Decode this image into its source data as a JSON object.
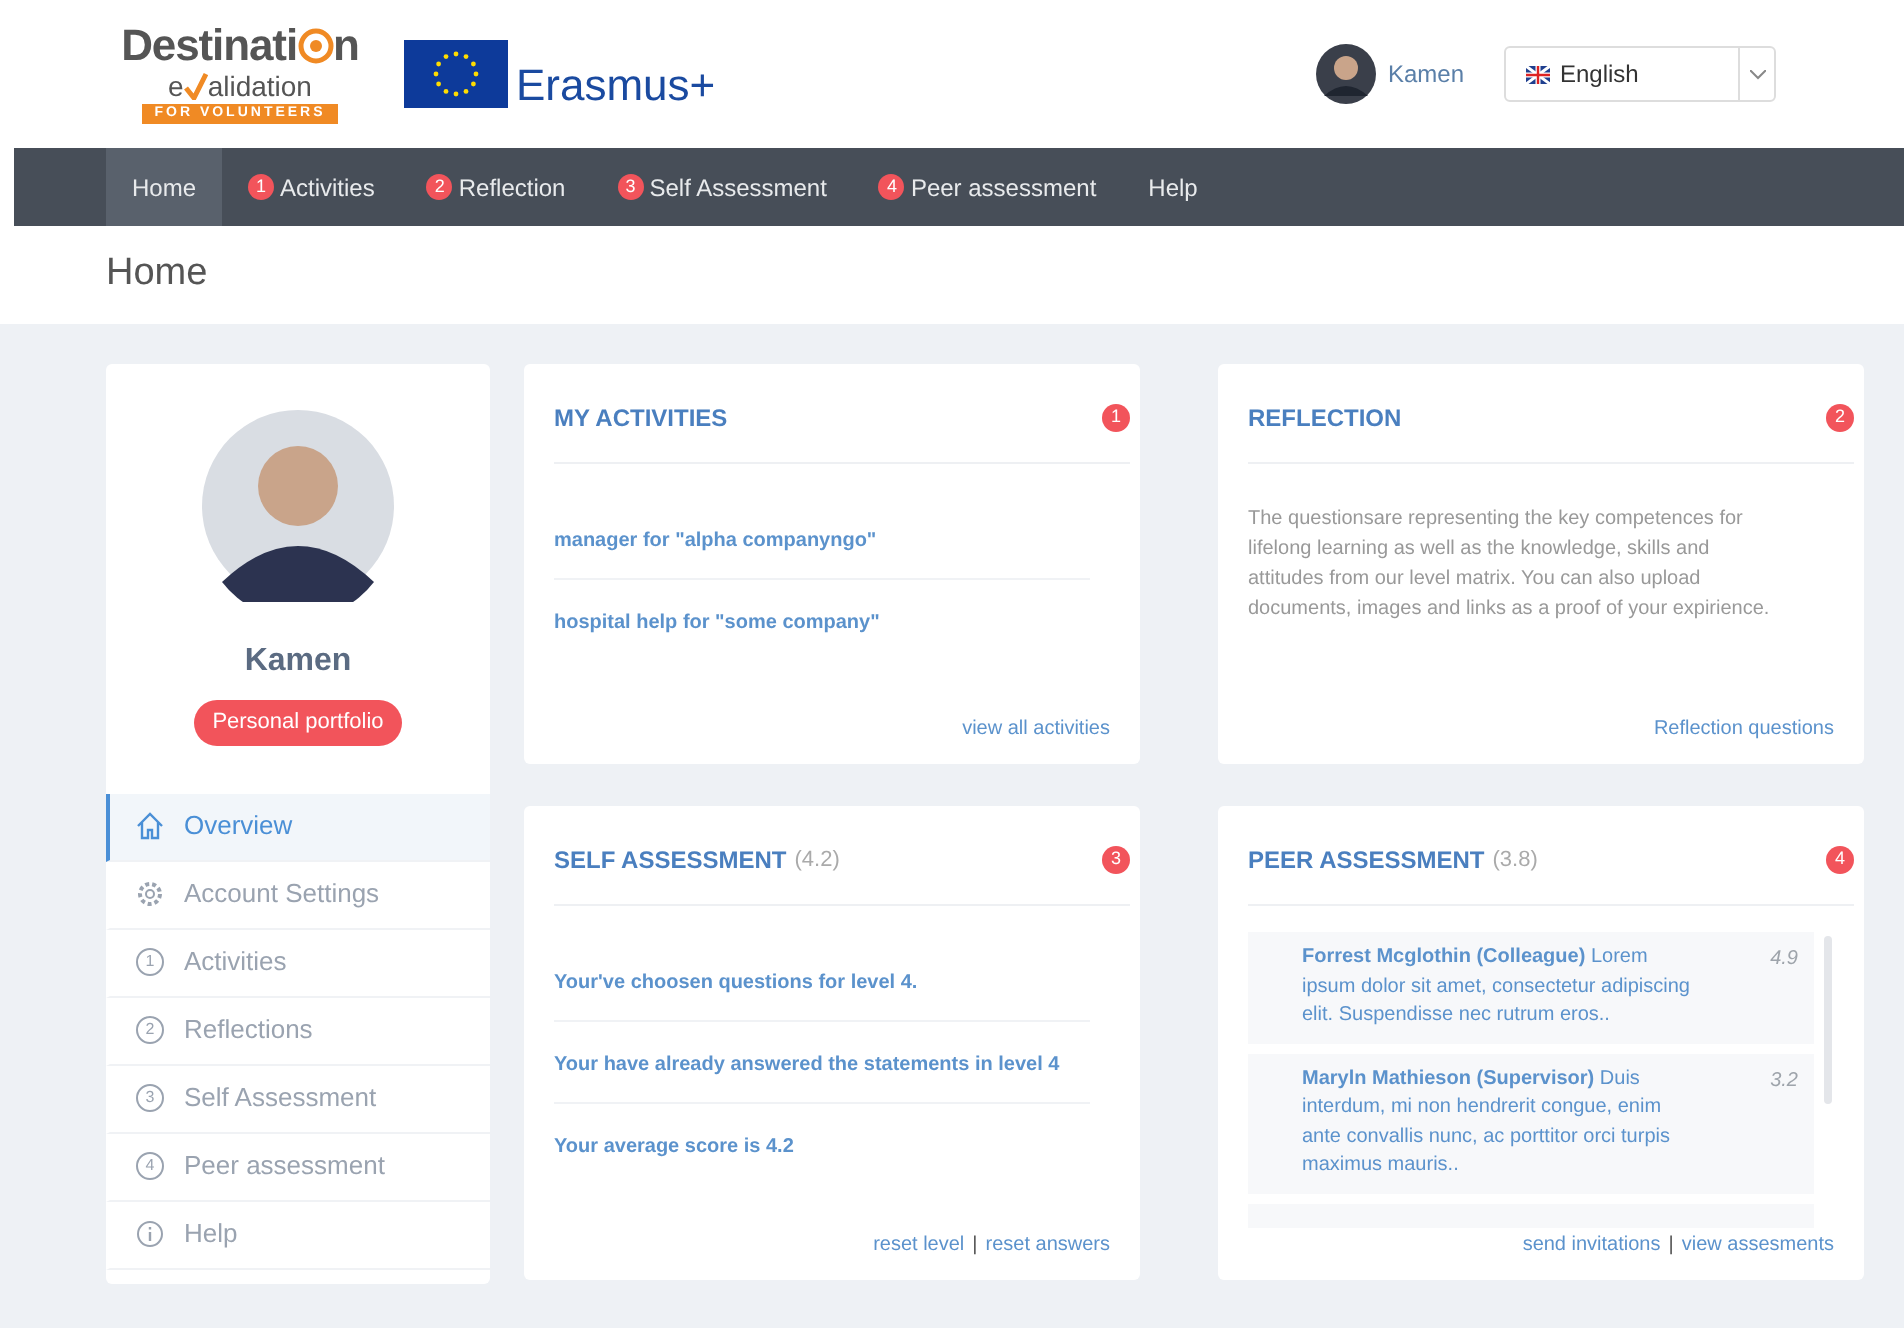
{
  "logo": {
    "word_start": "Destinati",
    "word_end": "n",
    "sub_start": "e",
    "sub_end": "alidation",
    "tagline": "FOR VOLUNTEERS"
  },
  "partner_logo": {
    "text": "Erasmus+"
  },
  "user": {
    "name": "Kamen"
  },
  "language": {
    "value": "English"
  },
  "nav": [
    {
      "label": "Home",
      "selected": true
    },
    {
      "label": "Activities",
      "badge": "1",
      "selected": false
    },
    {
      "label": "Reflection",
      "badge": "2",
      "selected": false
    },
    {
      "label": "Self Assessment",
      "badge": "3",
      "selected": false
    },
    {
      "label": "Peer assessment",
      "badge": "4",
      "selected": false
    },
    {
      "label": "Help",
      "selected": false
    }
  ],
  "page_title": "Home",
  "profile": {
    "name": "Kamen",
    "button": "Personal portfolio"
  },
  "sidebar": [
    {
      "label": "Overview",
      "kind": "home",
      "selected": true
    },
    {
      "label": "Account Settings",
      "kind": "settings",
      "selected": false
    },
    {
      "label": "Activities",
      "kind": "numbered",
      "number": "1",
      "selected": false
    },
    {
      "label": "Reflections",
      "kind": "numbered",
      "number": "2",
      "selected": false
    },
    {
      "label": "Self Assessment",
      "kind": "numbered",
      "number": "3",
      "selected": false
    },
    {
      "label": "Peer assessment",
      "kind": "numbered",
      "number": "4",
      "selected": false
    },
    {
      "label": "Help",
      "kind": "info",
      "selected": false
    }
  ],
  "cards": [
    {
      "kind": "links",
      "title": "MY ACTIVITIES",
      "badge": "1",
      "items": [
        "manager for \"alpha companyngo\"",
        "hospital help for \"some company\""
      ],
      "actions": [
        "view all activities"
      ]
    },
    {
      "kind": "text",
      "title": "REFLECTION",
      "badge": "2",
      "text": "The questionsare representing the key competences for lifelong learning as well as the knowledge, skills and attitudes from our level matrix. You can also upload documents, images and links as a proof of your expirience.",
      "actions": [
        "Reflection questions"
      ]
    },
    {
      "kind": "links",
      "title": "SELF ASSESSMENT",
      "score": "(4.2)",
      "badge": "3",
      "items": [
        "Your've choosen questions for level 4.",
        "Your have already answered the statements in level 4",
        "Your average score is 4.2"
      ],
      "actions": [
        "reset level",
        "reset answers"
      ],
      "separator": "|"
    },
    {
      "kind": "reviews",
      "title": "PEER ASSESSMENT",
      "score": "(3.8)",
      "badge": "4",
      "reviews": [
        {
          "author": "Forrest Mcglothin (Colleague)",
          "text": "Lorem ipsum dolor sit amet, consectetur adipiscing elit. Suspendisse nec rutrum eros..",
          "score": "4.9"
        },
        {
          "author": "Maryln Mathieson (Supervisor)",
          "text": "Duis interdum, mi non hendrerit congue, enim ante convallis nunc, ac porttitor orci turpis maximus mauris..",
          "score": "3.2"
        }
      ],
      "actions": [
        "send invitations",
        "view assesments"
      ],
      "separator": "|"
    }
  ]
}
